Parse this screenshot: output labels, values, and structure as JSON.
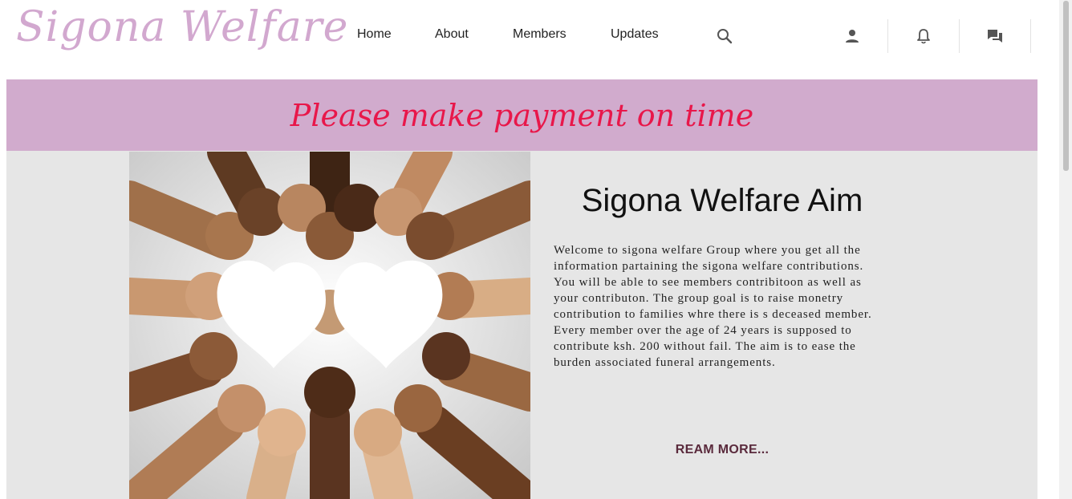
{
  "header": {
    "logo": "Sigona Welfare",
    "nav": [
      {
        "label": "Home"
      },
      {
        "label": "About"
      },
      {
        "label": "Members"
      },
      {
        "label": "Updates"
      }
    ],
    "icons": [
      "search-icon",
      "person-icon",
      "bell-icon",
      "chat-icon"
    ]
  },
  "banner": {
    "text": "Please make payment on time"
  },
  "main": {
    "image_icon": "hands-heart-image",
    "title": "Sigona Welfare Aim",
    "body": "Welcome to sigona welfare Group where you get all the information partaining the sigona welfare contributions. You will be able to see members contribitoon as well as your contributon. The group goal is to raise monetry contribution to families whre there is s deceased member. Every member over the age of 24 years is supposed to contribute ksh. 200 without fail. The aim is to ease the burden associated funeral arrangements.",
    "read_more": "REAM MORE..."
  },
  "colors": {
    "logo": "#d2a8cf",
    "banner_bg": "#d1abcd",
    "banner_text": "#e8174a",
    "content_bg": "#e6e6e6",
    "read_more": "#5a2a3c"
  }
}
